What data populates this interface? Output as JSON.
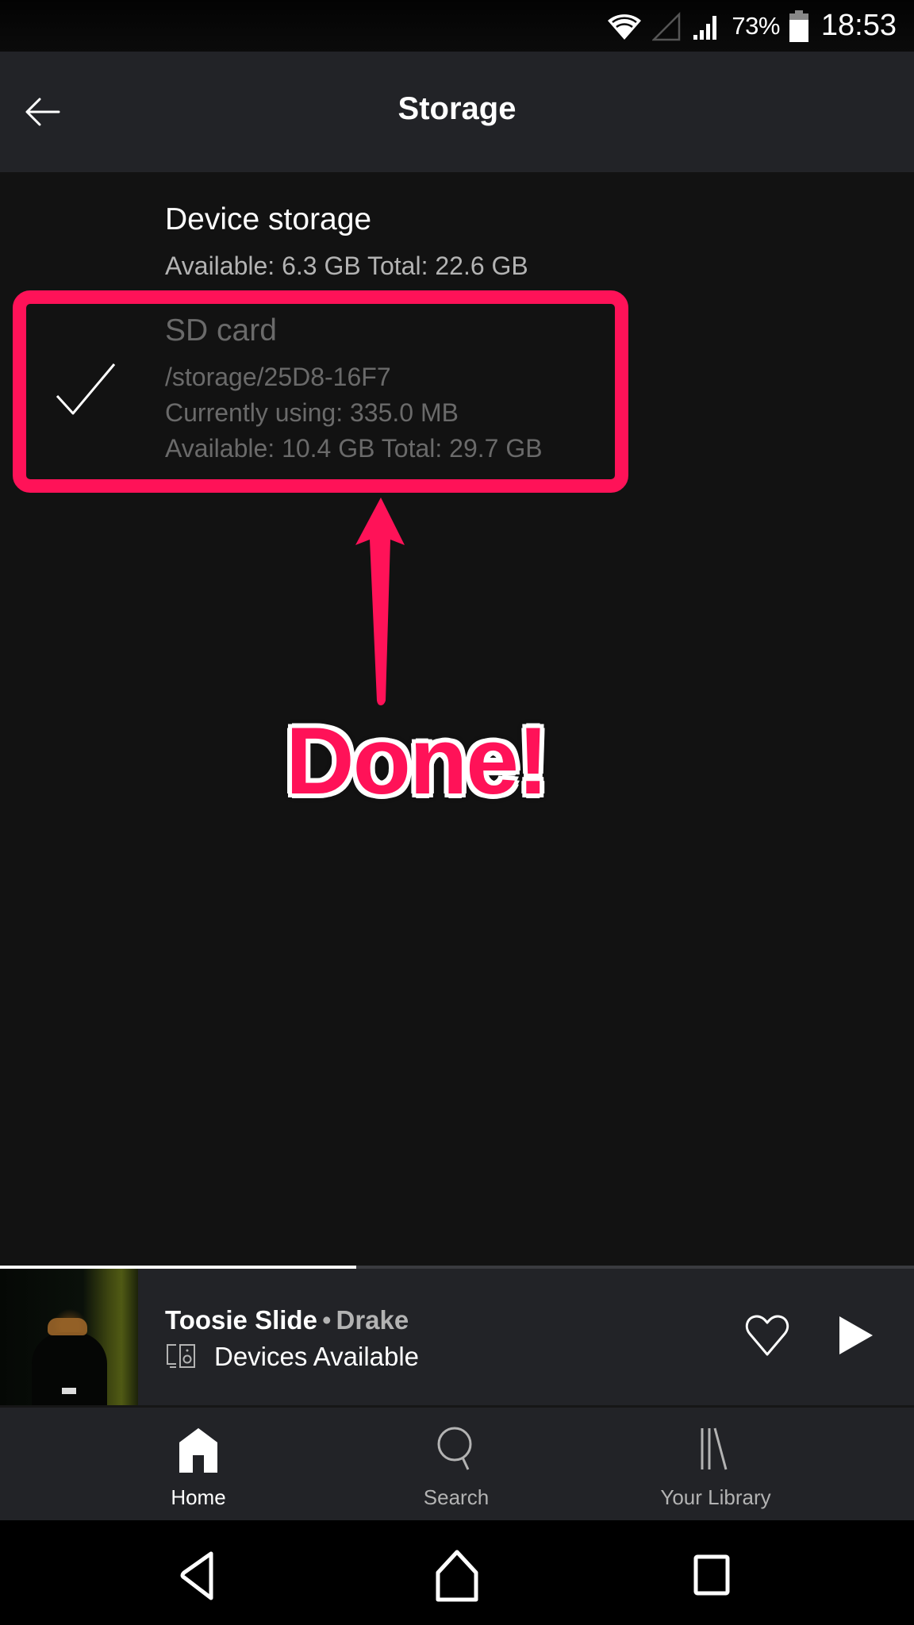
{
  "status_bar": {
    "battery_percent": "73%",
    "time": "18:53",
    "icons": [
      "wifi-icon",
      "no-sim-icon",
      "cell-signal-icon",
      "battery-icon"
    ]
  },
  "header": {
    "title": "Storage",
    "back_icon": "arrow-left-icon"
  },
  "storage_options": [
    {
      "title": "Device storage",
      "lines": [
        "Available: 6.3 GB Total: 22.6 GB"
      ],
      "selected": false
    },
    {
      "title": "SD card",
      "lines": [
        "/storage/25D8-16F7",
        "Currently using: 335.0 MB",
        "Available: 10.4 GB Total: 29.7 GB"
      ],
      "selected": true,
      "selected_icon": "checkmark-icon"
    }
  ],
  "annotation": {
    "text": "Done!",
    "color": "#ff1258"
  },
  "now_playing": {
    "track": "Toosie Slide",
    "separator": "•",
    "artist": "Drake",
    "devices_label": "Devices Available",
    "progress_fraction": 0.39,
    "liked": false
  },
  "bottom_nav": [
    {
      "label": "Home",
      "icon": "home-icon",
      "active": true
    },
    {
      "label": "Search",
      "icon": "search-icon",
      "active": false
    },
    {
      "label": "Your Library",
      "icon": "library-icon",
      "active": false
    }
  ],
  "colors": {
    "background": "#121212",
    "header": "#222327",
    "accent_annotation": "#ff1258",
    "text_secondary": "#b3b3b3",
    "text_disabled": "#6a6a6a"
  }
}
